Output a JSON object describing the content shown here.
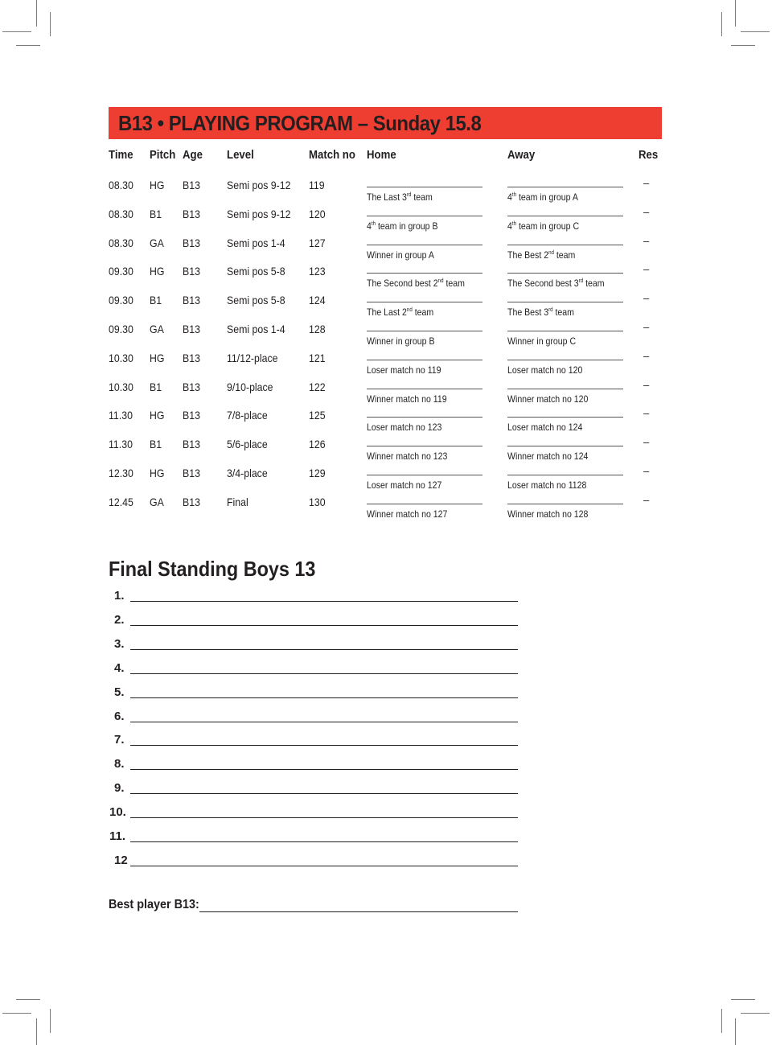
{
  "title": "B13 • PLAYING PROGRAM – Sunday 15.8",
  "colors": {
    "banner": "#ee3e32",
    "text": "#231f20"
  },
  "columns": {
    "time": "Time",
    "pitch": "Pitch",
    "age": "Age",
    "level": "Level",
    "match_no": "Match no",
    "home": "Home",
    "away": "Away",
    "res": "Res"
  },
  "matches": [
    {
      "time": "08.30",
      "pitch": "HG",
      "age": "B13",
      "level": "Semi pos 9-12",
      "match_no": "119",
      "home": {
        "pre": "The Last 3",
        "sup": "rd",
        "post": " team"
      },
      "away": {
        "pre": "4",
        "sup": "th",
        "post": " team in group A"
      },
      "res": "–"
    },
    {
      "time": "08.30",
      "pitch": "B1",
      "age": "B13",
      "level": "Semi pos 9-12",
      "match_no": "120",
      "home": {
        "pre": "4",
        "sup": "th",
        "post": " team in group B"
      },
      "away": {
        "pre": "4",
        "sup": "th",
        "post": " team in group C"
      },
      "res": "–"
    },
    {
      "time": "08.30",
      "pitch": "GA",
      "age": "B13",
      "level": "Semi pos 1-4",
      "match_no": "127",
      "home": {
        "pre": "Winner in group A",
        "sup": "",
        "post": ""
      },
      "away": {
        "pre": "The Best 2",
        "sup": "nd",
        "post": " team"
      },
      "res": "–"
    },
    {
      "time": "09.30",
      "pitch": "HG",
      "age": "B13",
      "level": "Semi pos 5-8",
      "match_no": "123",
      "home": {
        "pre": "The Second best 2",
        "sup": "nd",
        "post": " team"
      },
      "away": {
        "pre": "The Second best 3",
        "sup": "rd",
        "post": " team"
      },
      "res": "–"
    },
    {
      "time": "09.30",
      "pitch": "B1",
      "age": "B13",
      "level": "Semi pos 5-8",
      "match_no": "124",
      "home": {
        "pre": "The Last 2",
        "sup": "nd",
        "post": " team"
      },
      "away": {
        "pre": "The Best 3",
        "sup": "rd",
        "post": " team"
      },
      "res": "–"
    },
    {
      "time": "09.30",
      "pitch": "GA",
      "age": "B13",
      "level": "Semi pos 1-4",
      "match_no": "128",
      "home": {
        "pre": "Winner in group B",
        "sup": "",
        "post": ""
      },
      "away": {
        "pre": "Winner in group C",
        "sup": "",
        "post": ""
      },
      "res": "–"
    },
    {
      "time": "10.30",
      "pitch": "HG",
      "age": "B13",
      "level": "11/12-place",
      "match_no": "121",
      "home": {
        "pre": "Loser match no 119",
        "sup": "",
        "post": ""
      },
      "away": {
        "pre": "Loser match no 120",
        "sup": "",
        "post": ""
      },
      "res": "–"
    },
    {
      "time": "10.30",
      "pitch": "B1",
      "age": "B13",
      "level": "9/10-place",
      "match_no": "122",
      "home": {
        "pre": "Winner match no 119",
        "sup": "",
        "post": ""
      },
      "away": {
        "pre": "Winner match no 120",
        "sup": "",
        "post": ""
      },
      "res": "–"
    },
    {
      "time": "11.30",
      "pitch": "HG",
      "age": "B13",
      "level": "7/8-place",
      "match_no": "125",
      "home": {
        "pre": "Loser match no 123",
        "sup": "",
        "post": ""
      },
      "away": {
        "pre": "Loser match no 124",
        "sup": "",
        "post": ""
      },
      "res": "–"
    },
    {
      "time": "11.30",
      "pitch": "B1",
      "age": "B13",
      "level": "5/6-place",
      "match_no": "126",
      "home": {
        "pre": "Winner match no 123",
        "sup": "",
        "post": ""
      },
      "away": {
        "pre": "Winner match no 124",
        "sup": "",
        "post": ""
      },
      "res": "–"
    },
    {
      "time": "12.30",
      "pitch": "HG",
      "age": "B13",
      "level": "3/4-place",
      "match_no": "129",
      "home": {
        "pre": "Loser match no 127",
        "sup": "",
        "post": ""
      },
      "away": {
        "pre": "Loser match no 1128",
        "sup": "",
        "post": ""
      },
      "res": "–"
    },
    {
      "time": "12.45",
      "pitch": "GA",
      "age": "B13",
      "level": "Final",
      "match_no": "130",
      "home": {
        "pre": "Winner match no 127",
        "sup": "",
        "post": ""
      },
      "away": {
        "pre": "Winner match no 128",
        "sup": "",
        "post": ""
      },
      "res": "–"
    }
  ],
  "final_standing": {
    "title": "Final Standing Boys 13",
    "ranks": [
      "1.",
      "2.",
      "3.",
      "4.",
      "5.",
      "6.",
      "7.",
      "8.",
      "9.",
      "10.",
      "11.",
      "12"
    ]
  },
  "best_player": {
    "label": "Best player B13:"
  }
}
